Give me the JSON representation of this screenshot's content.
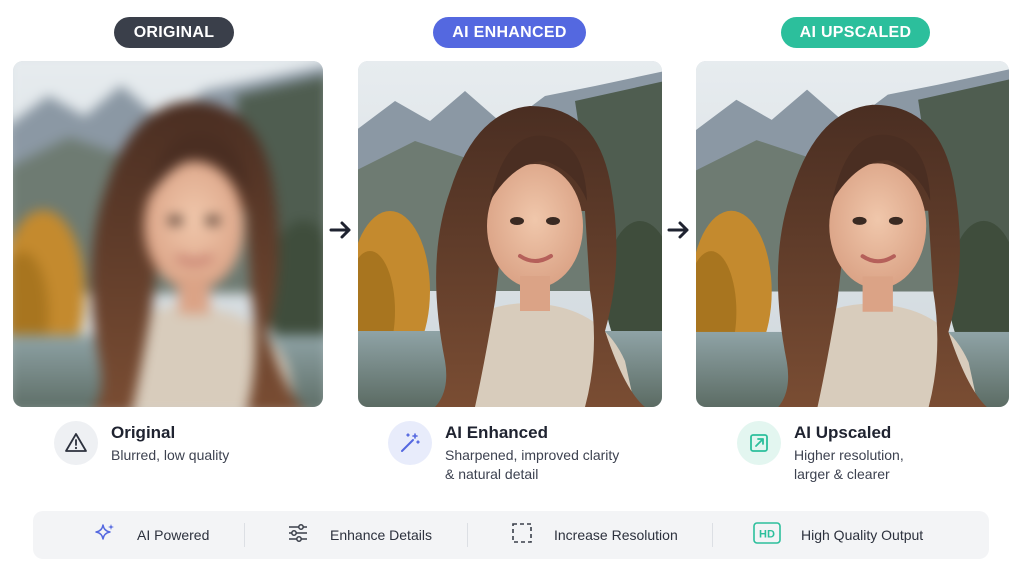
{
  "badges": [
    "ORIGINAL",
    "AI ENHANCED",
    "AI UPSCALED"
  ],
  "features": [
    {
      "title": "Original",
      "desc": [
        "Blurred, low quality"
      ],
      "icon": "warning-icon"
    },
    {
      "title": "AI Enhanced",
      "desc": [
        "Sharpened, improved clarity",
        "& natural detail"
      ],
      "icon": "magic-wand-icon"
    },
    {
      "title": "AI Upscaled",
      "desc": [
        "Higher resolution,",
        "larger & clearer"
      ],
      "icon": "expand-icon"
    }
  ],
  "bottom_bar": [
    {
      "label": "AI Powered",
      "icon": "sparkle-icon"
    },
    {
      "label": "Enhance Details",
      "icon": "sliders-icon"
    },
    {
      "label": "Increase Resolution",
      "icon": "crop-frame-icon"
    },
    {
      "label": "High Quality Output",
      "icon": "hd-icon",
      "icon_text": "HD"
    }
  ],
  "colors": {
    "original_badge": "#3a3f4a",
    "enhanced_badge": "#5468e0",
    "upscaled_badge": "#2cbf9c"
  }
}
